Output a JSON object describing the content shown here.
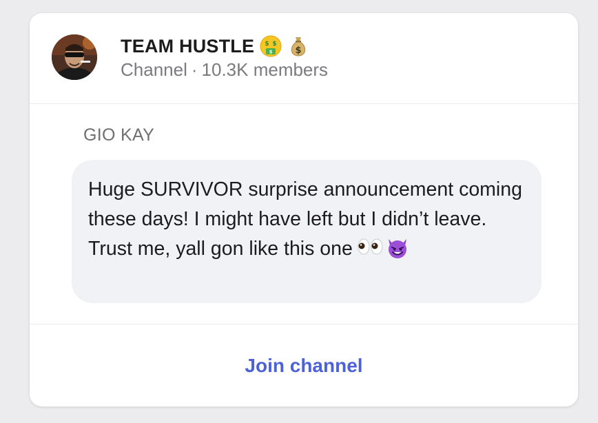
{
  "channel": {
    "name": "TEAM HUSTLE",
    "title_emojis": [
      "money-mouth-face-icon",
      "money-bag-icon"
    ],
    "type_label": "Channel",
    "separator": "·",
    "members": "10.3K members"
  },
  "post": {
    "sender": "GIO KAY",
    "message": "Huge SURVIVOR surprise announcement coming these days! I might have left but I didn’t leave. Trust me, yall gon like this one",
    "trailing_emojis": [
      "eyes-icon",
      "smiling-devil-icon"
    ]
  },
  "footer": {
    "join_label": "Join channel"
  },
  "colors": {
    "accent": "#4c62d6",
    "bubble": "#f1f2f5",
    "background": "#ececee"
  }
}
